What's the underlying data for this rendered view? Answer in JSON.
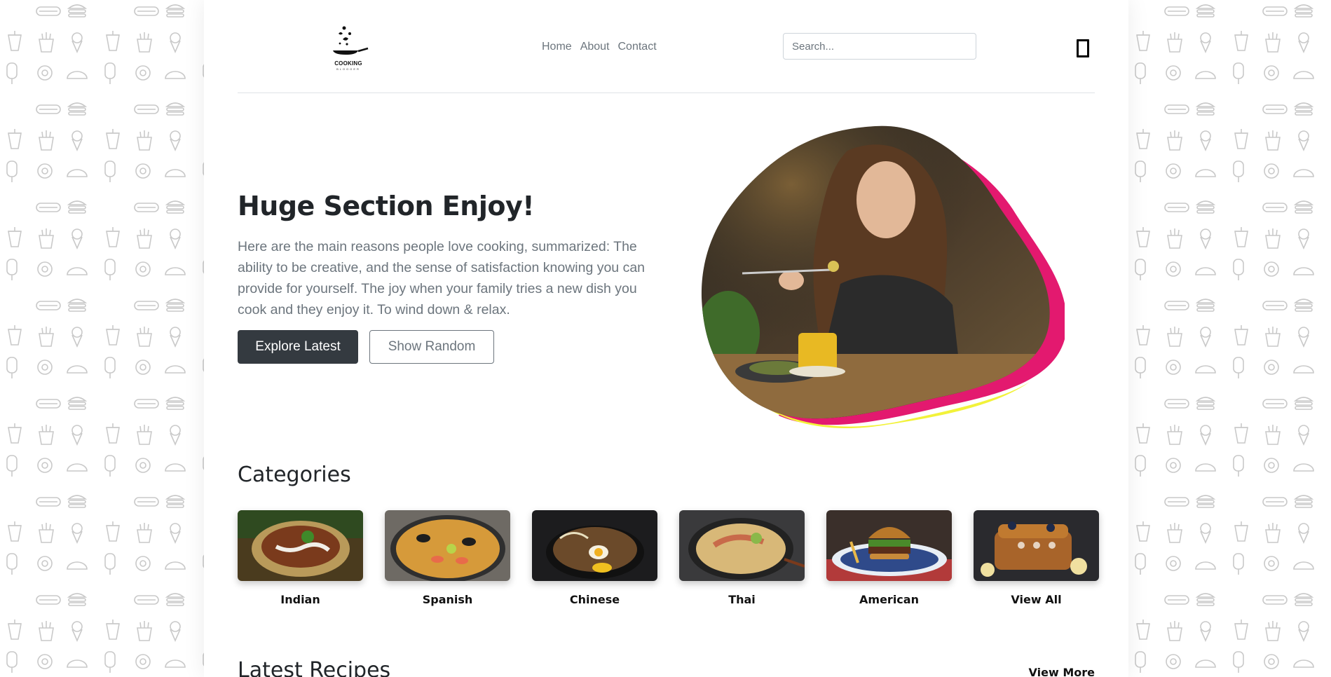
{
  "header": {
    "logo": {
      "text": "COOKING",
      "subtext": "BLOGGER"
    },
    "nav": [
      {
        "label": "Home"
      },
      {
        "label": "About"
      },
      {
        "label": "Contact"
      }
    ],
    "search": {
      "placeholder": "Search...",
      "value": ""
    },
    "menu_icon": "square-outline-icon"
  },
  "hero": {
    "title": "Huge Section Enjoy!",
    "text": "Here are the main reasons people love cooking, summarized: The ability to be creative, and the sense of satisfaction knowing you can provide for yourself. The joy when your family tries a new dish you cook and they enjoy it. To wind down & relax.",
    "primary_button": "Explore Latest",
    "secondary_button": "Show Random",
    "blob_colors": {
      "accent_pink": "#e3196f",
      "accent_yellow": "#f2f23a"
    }
  },
  "categories": {
    "title": "Categories",
    "items": [
      {
        "label": "Indian"
      },
      {
        "label": "Spanish"
      },
      {
        "label": "Chinese"
      },
      {
        "label": "Thai"
      },
      {
        "label": "American"
      },
      {
        "label": "View All"
      }
    ]
  },
  "latest": {
    "title": "Latest Recipes",
    "view_more": "View More"
  },
  "colors": {
    "dark_button": "#343a40",
    "muted_text": "#6c757d",
    "border": "#dee2e6"
  }
}
